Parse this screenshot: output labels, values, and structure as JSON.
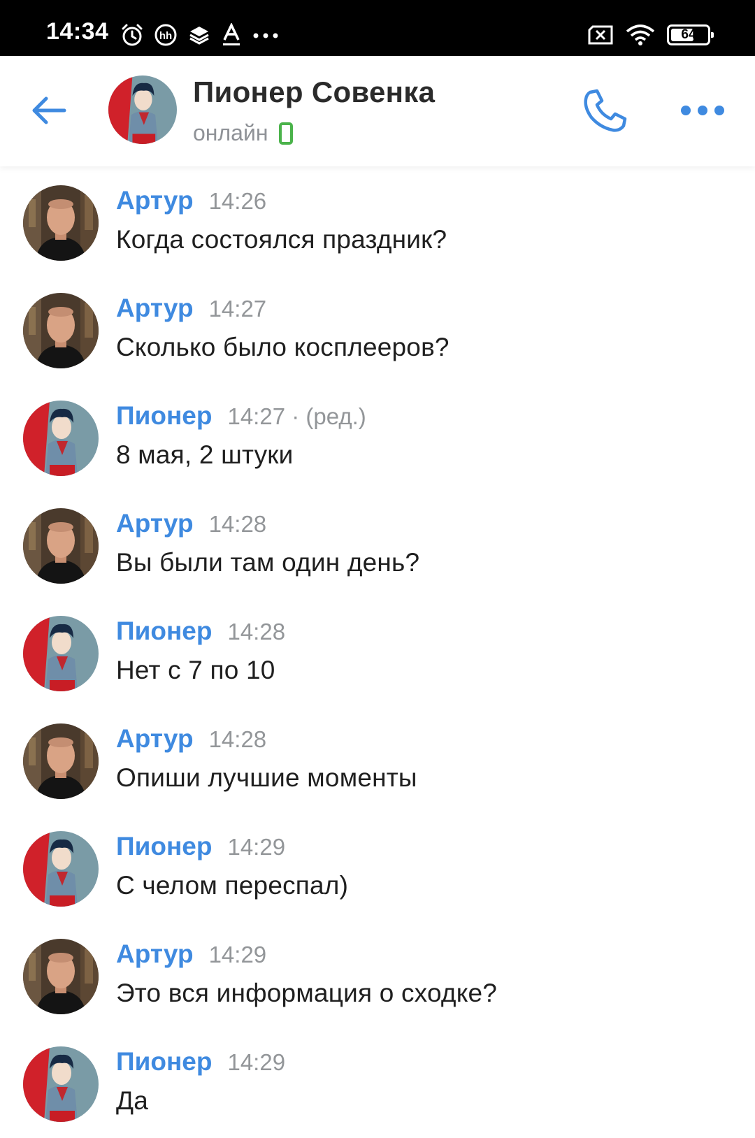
{
  "status_bar": {
    "time": "14:34",
    "battery": "64",
    "battery_level": 0.64,
    "icons_left": [
      "alarm-icon",
      "hh-icon",
      "layers-icon",
      "font-a-icon",
      "more-dots-icon"
    ],
    "icons_right": [
      "sim-off-icon",
      "wifi-icon",
      "battery-icon"
    ]
  },
  "header": {
    "name": "Пионер Совенка",
    "status": "онлайн",
    "accent_color": "#3f8ae0",
    "online_color": "#4bb34b"
  },
  "messages": [
    {
      "author": "Артур",
      "time": "14:26",
      "text": "Когда состоялся праздник?",
      "avatar": "artur"
    },
    {
      "author": "Артур",
      "time": "14:27",
      "text": "Сколько было косплееров?",
      "avatar": "artur"
    },
    {
      "author": "Пионер",
      "time": "14:27 · (ред.)",
      "text": "8 мая, 2 штуки",
      "avatar": "pioneer"
    },
    {
      "author": "Артур",
      "time": "14:28",
      "text": "Вы были там один день?",
      "avatar": "artur"
    },
    {
      "author": "Пионер",
      "time": "14:28",
      "text": "Нет с 7 по 10",
      "avatar": "pioneer"
    },
    {
      "author": "Артур",
      "time": "14:28",
      "text": "Опиши лучшие моменты",
      "avatar": "artur"
    },
    {
      "author": "Пионер",
      "time": "14:29",
      "text": "С челом переспал)",
      "avatar": "pioneer"
    },
    {
      "author": "Артур",
      "time": "14:29",
      "text": "Это вся информация о сходке?",
      "avatar": "artur"
    },
    {
      "author": "Пионер",
      "time": "14:29",
      "text": "Да",
      "avatar": "pioneer"
    }
  ]
}
